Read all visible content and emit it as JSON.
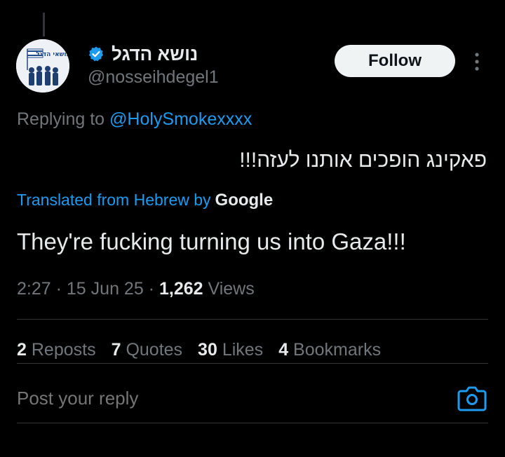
{
  "tweet": {
    "author": {
      "display_name": "נושא הדגל",
      "handle": "@nosseihdegel1",
      "verified": true,
      "avatar_text": "נושאי הדגל"
    },
    "follow_label": "Follow",
    "replying_prefix": "Replying to",
    "replying_to": "@HolySmokexxxx",
    "original_text": "פאקינג הופכים אותנו לעזה!!!",
    "translated_prefix": "Translated from Hebrew by",
    "translated_provider": "Google",
    "translation": "They're fucking turning us into Gaza!!!",
    "time": "2:27",
    "date": "15 Jun 25",
    "views_count": "1,262",
    "views_label": "Views",
    "stats": {
      "reposts_count": "2",
      "reposts_label": "Reposts",
      "quotes_count": "7",
      "quotes_label": "Quotes",
      "likes_count": "30",
      "likes_label": "Likes",
      "bookmarks_count": "4",
      "bookmarks_label": "Bookmarks"
    }
  },
  "reply": {
    "placeholder": "Post your reply"
  },
  "colors": {
    "background": "#000000",
    "accent": "#1d9bf0",
    "muted": "#71767b",
    "text": "#e7e9ea"
  }
}
